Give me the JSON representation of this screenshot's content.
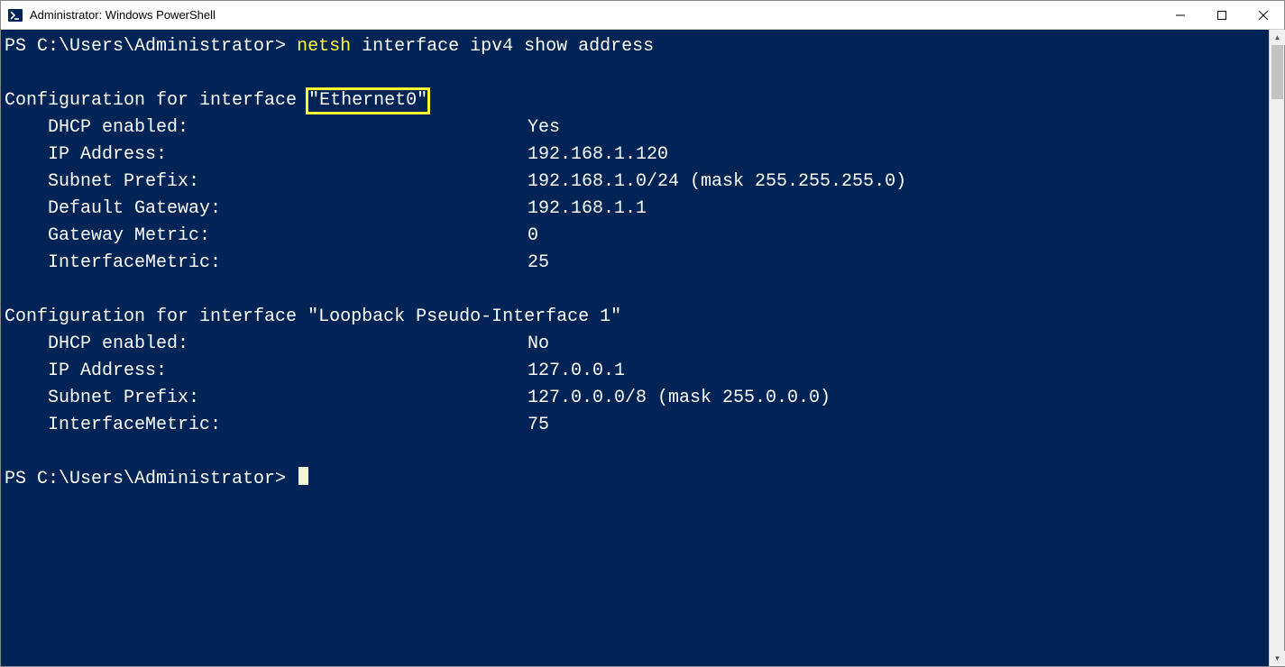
{
  "window": {
    "title": "Administrator: Windows PowerShell"
  },
  "session": {
    "prompt": "PS C:\\Users\\Administrator>",
    "command_first_word": "netsh",
    "command_rest": " interface ipv4 show address"
  },
  "interfaces": [
    {
      "header_prefix": "Configuration for interface ",
      "name_quoted": "\"Ethernet0\"",
      "highlighted": true,
      "fields": [
        {
          "label": "DHCP enabled:",
          "value": "Yes"
        },
        {
          "label": "IP Address:",
          "value": "192.168.1.120"
        },
        {
          "label": "Subnet Prefix:",
          "value": "192.168.1.0/24 (mask 255.255.255.0)"
        },
        {
          "label": "Default Gateway:",
          "value": "192.168.1.1"
        },
        {
          "label": "Gateway Metric:",
          "value": "0"
        },
        {
          "label": "InterfaceMetric:",
          "value": "25"
        }
      ]
    },
    {
      "header_prefix": "Configuration for interface ",
      "name_quoted": "\"Loopback Pseudo-Interface 1\"",
      "highlighted": false,
      "fields": [
        {
          "label": "DHCP enabled:",
          "value": "No"
        },
        {
          "label": "IP Address:",
          "value": "127.0.0.1"
        },
        {
          "label": "Subnet Prefix:",
          "value": "127.0.0.0/8 (mask 255.0.0.0)"
        },
        {
          "label": "InterfaceMetric:",
          "value": "75"
        }
      ]
    }
  ]
}
